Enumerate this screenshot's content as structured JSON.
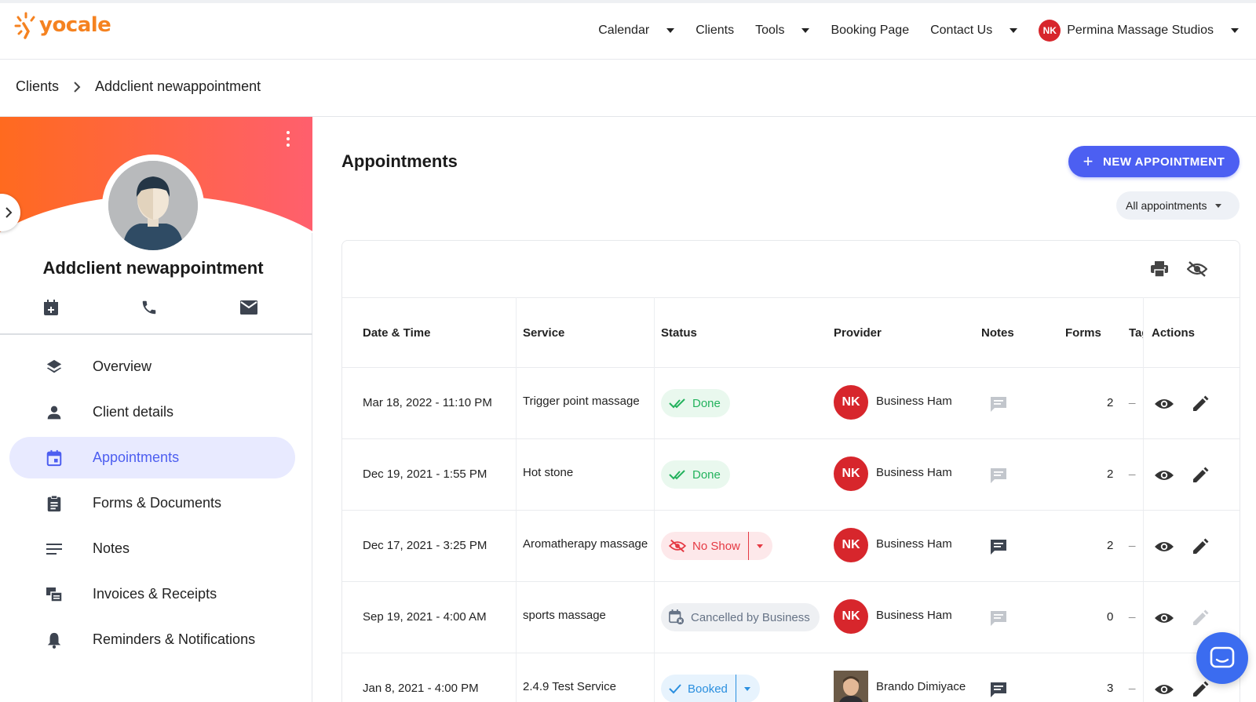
{
  "brand": {
    "name": "yocale",
    "accent": "#f58220",
    "primary": "#4c5ff2"
  },
  "nav": {
    "items": [
      {
        "label": "Calendar",
        "dropdown": true
      },
      {
        "label": "Clients",
        "dropdown": false
      },
      {
        "label": "Tools",
        "dropdown": true
      },
      {
        "label": "Booking Page",
        "dropdown": false
      },
      {
        "label": "Contact Us",
        "dropdown": true
      }
    ],
    "business": {
      "initials": "NK",
      "name": "Permina Massage Studios"
    }
  },
  "breadcrumb": {
    "root": "Clients",
    "current": "Addclient newappointment"
  },
  "client": {
    "name": "Addclient newappointment",
    "quick_actions": [
      "calendar-add-icon",
      "phone-icon",
      "email-icon"
    ]
  },
  "menu": [
    {
      "label": "Overview",
      "icon": "layers-icon",
      "active": false
    },
    {
      "label": "Client details",
      "icon": "person-icon",
      "active": false
    },
    {
      "label": "Appointments",
      "icon": "calendar-icon",
      "active": true
    },
    {
      "label": "Forms & Documents",
      "icon": "clipboard-icon",
      "active": false
    },
    {
      "label": "Notes",
      "icon": "notes-icon",
      "active": false
    },
    {
      "label": "Invoices & Receipts",
      "icon": "invoice-icon",
      "active": false
    },
    {
      "label": "Reminders & Notifications",
      "icon": "bell-icon",
      "active": false
    }
  ],
  "main": {
    "title": "Appointments",
    "new_button": "NEW APPOINTMENT",
    "filter": "All appointments"
  },
  "table": {
    "columns": [
      "Date & Time",
      "Service",
      "Status",
      "Provider",
      "Notes",
      "Forms",
      "Tag",
      "Actions"
    ],
    "rows": [
      {
        "datetime": "Mar 18, 2022 - 11:10 PM",
        "service": "Trigger point massage",
        "status": "Done",
        "status_type": "done",
        "provider": "Business Ham",
        "provider_initials": "NK",
        "forms": "2",
        "tag": "_",
        "notes_active": false,
        "edit_enabled": true
      },
      {
        "datetime": "Dec 19, 2021 - 1:55 PM",
        "service": "Hot stone",
        "status": "Done",
        "status_type": "done",
        "provider": "Business Ham",
        "provider_initials": "NK",
        "forms": "2",
        "tag": "_",
        "notes_active": false,
        "edit_enabled": true
      },
      {
        "datetime": "Dec 17, 2021 - 3:25 PM",
        "service": "Aromatherapy massage",
        "status": "No Show",
        "status_type": "noshow",
        "provider": "Business Ham",
        "provider_initials": "NK",
        "forms": "2",
        "tag": "_",
        "notes_active": true,
        "edit_enabled": true
      },
      {
        "datetime": "Sep 19, 2021 - 4:00 AM",
        "service": "sports massage",
        "status": "Cancelled by Business",
        "status_type": "cancel",
        "provider": "Business Ham",
        "provider_initials": "NK",
        "forms": "0",
        "tag": "_",
        "notes_active": false,
        "edit_enabled": false
      },
      {
        "datetime": "Jan 8, 2021 - 4:00 PM",
        "service": "2.4.9 Test Service",
        "status": "Booked",
        "status_type": "booked",
        "provider": "Brando Dimiyace",
        "provider_initials": "",
        "forms": "3",
        "tag": "_",
        "notes_active": true,
        "edit_enabled": true
      }
    ]
  },
  "status_colors": {
    "done": "#23b25d",
    "noshow": "#e53943",
    "cancel": "#667386",
    "booked": "#2a8fdf"
  }
}
